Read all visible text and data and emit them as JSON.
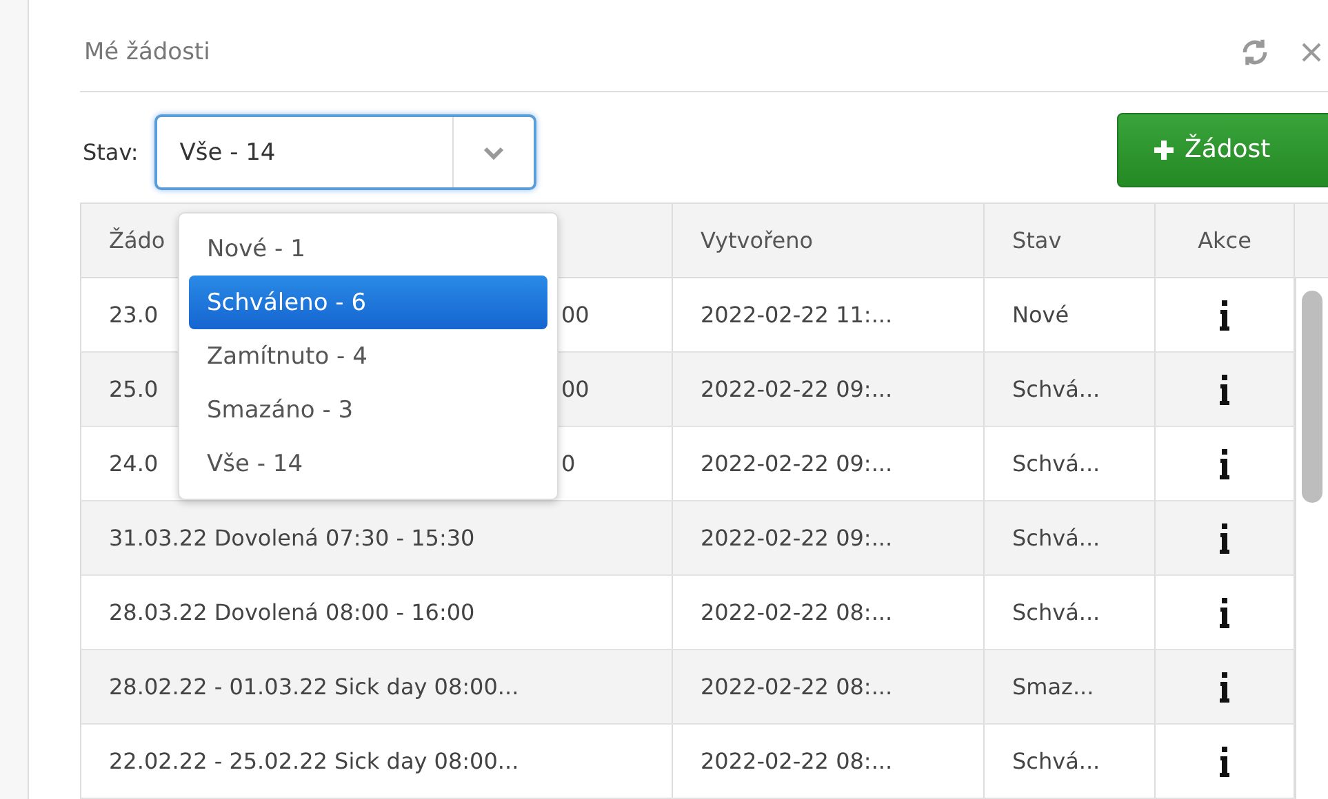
{
  "dialog": {
    "title": "Mé žádosti"
  },
  "filter": {
    "label": "Stav:",
    "value": "Vše - 14",
    "expanded": true,
    "options": [
      {
        "label": "Nové - 1",
        "highlighted": false
      },
      {
        "label": "Schváleno - 6",
        "highlighted": true
      },
      {
        "label": "Zamítnuto - 4",
        "highlighted": false
      },
      {
        "label": "Smazáno - 3",
        "highlighted": false
      },
      {
        "label": "Vše - 14",
        "highlighted": false
      }
    ]
  },
  "add_button": {
    "label": "Žádost"
  },
  "table": {
    "columns": [
      "Žádo",
      "Vytvořeno",
      "Stav",
      "Akce"
    ],
    "rows": [
      {
        "request": "23.0",
        "request_tail": "00",
        "created": "2022-02-22 11:...",
        "status": "Nové"
      },
      {
        "request": "25.0",
        "request_tail": "00",
        "created": "2022-02-22 09:...",
        "status": "Schvá..."
      },
      {
        "request": "24.0",
        "request_tail": "0",
        "created": "2022-02-22 09:...",
        "status": "Schvá..."
      },
      {
        "request": "31.03.22 Dovolená 07:30 - 15:30",
        "created": "2022-02-22 09:...",
        "status": "Schvá..."
      },
      {
        "request": "28.03.22 Dovolená 08:00 - 16:00",
        "created": "2022-02-22 08:...",
        "status": "Schvá..."
      },
      {
        "request": "28.02.22 - 01.03.22 Sick day 08:00...",
        "created": "2022-02-22 08:...",
        "status": "Smaz..."
      },
      {
        "request": "22.02.22 - 25.02.22 Sick day 08:00...",
        "created": "2022-02-22 08:...",
        "status": "Schvá..."
      }
    ]
  }
}
